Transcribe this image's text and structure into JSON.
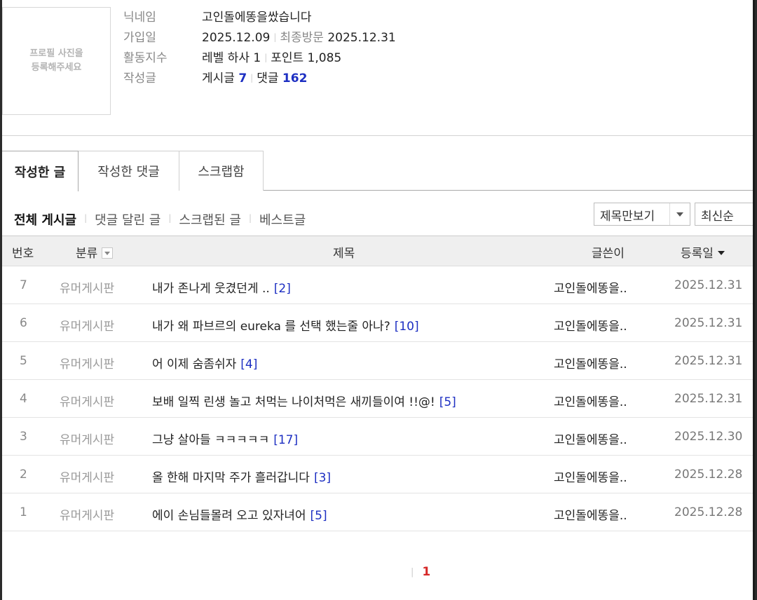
{
  "profile": {
    "photo_text_line1": "프로필 사진을",
    "photo_text_line2": "등록해주세요",
    "nickname_label": "닉네임",
    "nickname": "고인돌에똥을쌌습니다",
    "joined_label": "가입일",
    "joined": "2025.12.09",
    "last_visit_label": "최종방문",
    "last_visit": "2025.12.31",
    "activity_label": "활동지수",
    "level": "레벨 하사 1",
    "points": "포인트 1,085",
    "posts_label": "작성글",
    "post_count_label": "게시글",
    "post_count": "7",
    "comment_count_label": "댓글",
    "comment_count": "162"
  },
  "tabs": [
    "작성한 글",
    "작성한 댓글",
    "스크랩함"
  ],
  "filters": [
    "전체 게시글",
    "댓글 달린 글",
    "스크랩된 글",
    "베스트글"
  ],
  "view_select": "제목만보기",
  "sort_select": "최신순",
  "table": {
    "headers": {
      "no": "번호",
      "category": "분류",
      "title": "제목",
      "author": "글쓴이",
      "date": "등록일"
    },
    "rows": [
      {
        "no": "7",
        "category": "유머게시판",
        "title": "내가 존나게 웃겼던게 ..",
        "comments": "[2]",
        "author": "고인돌에똥을..",
        "date": "2025.12.31"
      },
      {
        "no": "6",
        "category": "유머게시판",
        "title": "내가 왜 파브르의 eureka 를 선택 했는줄 아나?",
        "comments": "[10]",
        "author": "고인돌에똥을..",
        "date": "2025.12.31"
      },
      {
        "no": "5",
        "category": "유머게시판",
        "title": "어 이제 숨좀쉬자",
        "comments": "[4]",
        "author": "고인돌에똥을..",
        "date": "2025.12.31"
      },
      {
        "no": "4",
        "category": "유머게시판",
        "title": "보배 일찍 린생 놀고 처먹는 나이처먹은 새끼들이여 !!@!",
        "comments": "[5]",
        "author": "고인돌에똥을..",
        "date": "2025.12.31"
      },
      {
        "no": "3",
        "category": "유머게시판",
        "title": "그냥 살아들 ㅋㅋㅋㅋㅋ",
        "comments": "[17]",
        "author": "고인돌에똥을..",
        "date": "2025.12.30"
      },
      {
        "no": "2",
        "category": "유머게시판",
        "title": "올 한해 마지막 주가 흘러갑니다",
        "comments": "[3]",
        "author": "고인돌에똥을..",
        "date": "2025.12.28"
      },
      {
        "no": "1",
        "category": "유머게시판",
        "title": "에이 손님들몰려 오고 있자녀어",
        "comments": "[5]",
        "author": "고인돌에똥을..",
        "date": "2025.12.28"
      }
    ]
  },
  "pagination": {
    "current": "1"
  },
  "colors": {
    "link_blue": "#1d2fc2",
    "current_page_red": "#d62828"
  }
}
